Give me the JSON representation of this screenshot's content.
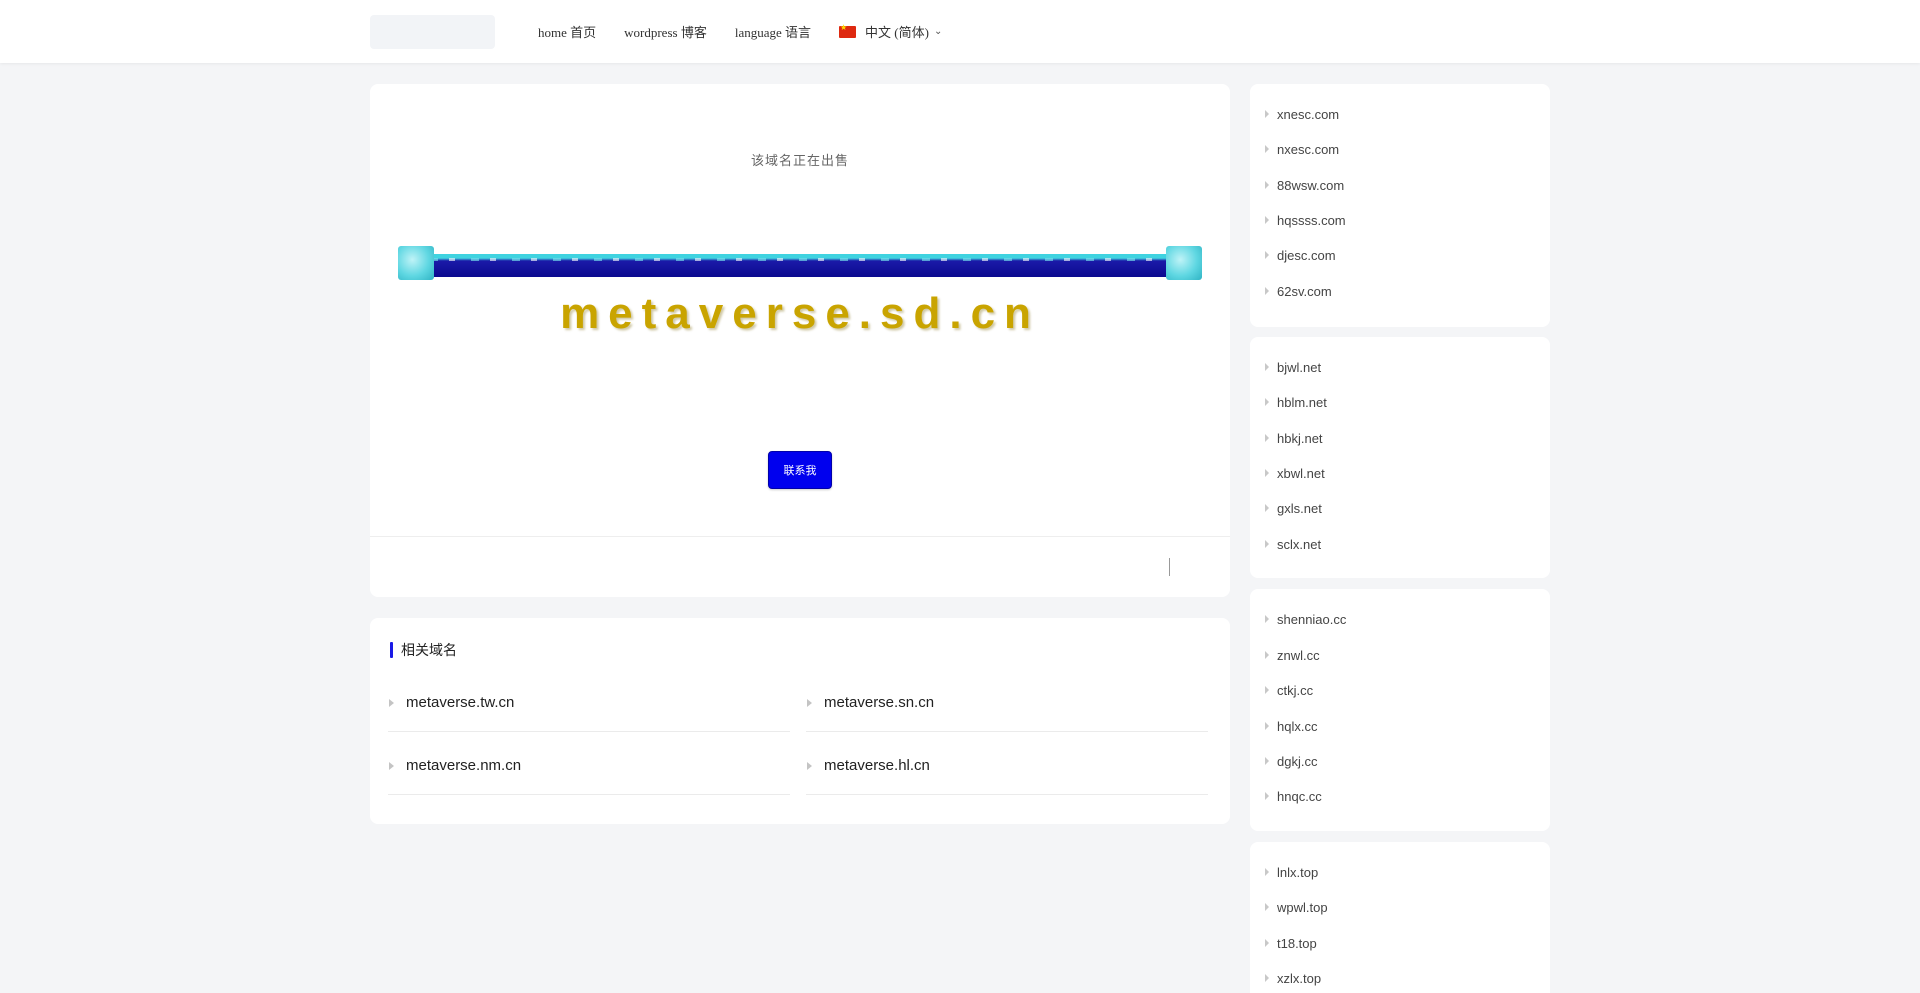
{
  "header": {
    "nav": [
      {
        "label": "home 首页"
      },
      {
        "label": "wordpress 博客"
      },
      {
        "label": "language 语言"
      }
    ],
    "language": {
      "label": "中文 (简体)",
      "flag": "cn-flag-icon",
      "dropdown_icon": "chevron-down-icon"
    }
  },
  "main": {
    "notice": "该域名正在出售",
    "domain": "metaverse.sd.cn",
    "button_label": "联系我"
  },
  "related": {
    "title": "相关域名",
    "accent_color": "#1a1ae6",
    "items": [
      {
        "label": "metaverse.tw.cn"
      },
      {
        "label": "metaverse.sn.cn"
      },
      {
        "label": "metaverse.nm.cn"
      },
      {
        "label": "metaverse.hl.cn"
      }
    ]
  },
  "sidebar": {
    "groups": [
      {
        "items": [
          "xnesc.com",
          "nxesc.com",
          "88wsw.com",
          "hqssss.com",
          "djesc.com",
          "62sv.com"
        ]
      },
      {
        "items": [
          "bjwl.net",
          "hblm.net",
          "hbkj.net",
          "xbwl.net",
          "gxls.net",
          "sclx.net"
        ]
      },
      {
        "items": [
          "shenniao.cc",
          "znwl.cc",
          "ctkj.cc",
          "hqlx.cc",
          "dgkj.cc",
          "hnqc.cc"
        ]
      },
      {
        "items": [
          "lnlx.top",
          "wpwl.top",
          "t18.top",
          "xzlx.top"
        ]
      }
    ]
  },
  "colors": {
    "button": "#0000ee",
    "domain_text": "#c9a400",
    "page_bg": "#f4f5f7"
  }
}
